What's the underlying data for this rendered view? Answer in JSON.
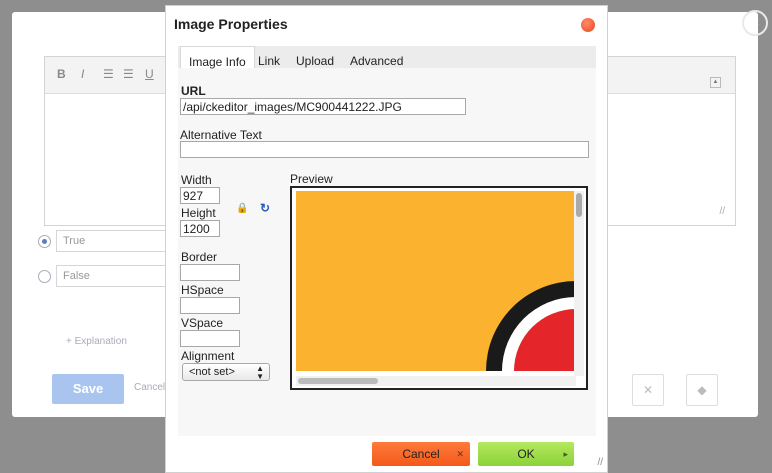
{
  "background": {
    "toolbar_tools": [
      "B",
      "I",
      "☰",
      "☰",
      "U"
    ],
    "options": [
      {
        "label": "True",
        "checked": true
      },
      {
        "label": "False",
        "checked": false
      }
    ],
    "explanation_link": "+ Explanation",
    "save_label": "Save",
    "cancel_label": "Cancel",
    "close_glyph": "×"
  },
  "dialog": {
    "title": "Image Properties",
    "tabs": [
      "Image Info",
      "Link",
      "Upload",
      "Advanced"
    ],
    "url_label": "URL",
    "url_value": "/api/ckeditor_images/MC900441222.JPG",
    "alt_label": "Alternative Text",
    "alt_value": "",
    "width_label": "Width",
    "width_value": "927",
    "height_label": "Height",
    "height_value": "1200",
    "border_label": "Border",
    "border_value": "",
    "hspace_label": "HSpace",
    "hspace_value": "",
    "vspace_label": "VSpace",
    "vspace_value": "",
    "alignment_label": "Alignment",
    "alignment_value": "<not set>",
    "preview_label": "Preview",
    "cancel_label": "Cancel",
    "ok_label": "OK"
  },
  "colors": {
    "overlay": "#8e8e8e",
    "save_button": "#a9c5ef",
    "cancel_button": "#f35a1a",
    "ok_button": "#8bd23a",
    "preview_image": "#fbb32f"
  }
}
